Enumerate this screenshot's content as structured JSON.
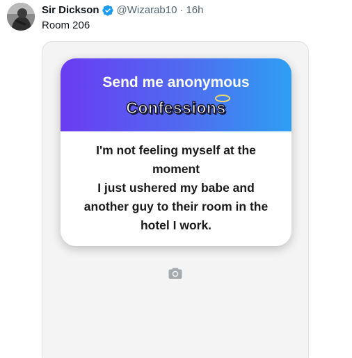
{
  "tweet": {
    "display_name": "Sir Dickson",
    "handle": "@Wizarab10",
    "separator": "·",
    "time": "16h",
    "text": "Room 206"
  },
  "media": {
    "card": {
      "title": "Send me anonymous",
      "subtitle": "Confessions",
      "lines": [
        "I'm not feeling myself at the",
        "moment",
        "I just ushered my babe and",
        "another guy to their room in the",
        "hotel I work."
      ]
    },
    "icons": {
      "verified": "verified-badge-icon",
      "camera": "camera-icon"
    }
  },
  "colors": {
    "verified_blue": "#1d9bf0",
    "gradient_start": "#6a3cf2",
    "gradient_end": "#2e9ff3",
    "secondary_text": "#536471"
  }
}
